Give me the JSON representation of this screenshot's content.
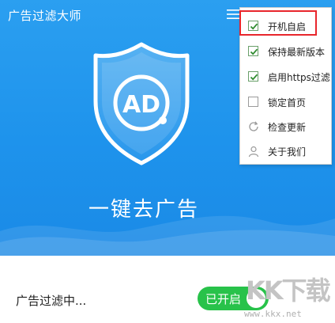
{
  "window": {
    "title": "广告过滤大师"
  },
  "hero": {
    "logo_text": "AD",
    "slogan": "一键去广告"
  },
  "footer": {
    "status_text": "广告过滤中...",
    "toggle_label": "已开启",
    "toggle_on": true
  },
  "menu": {
    "items": [
      {
        "label": "开机自启",
        "type": "checkbox",
        "checked": true,
        "highlighted": true
      },
      {
        "label": "保持最新版本",
        "type": "checkbox",
        "checked": true
      },
      {
        "label": "启用https过滤",
        "type": "checkbox",
        "checked": true
      },
      {
        "label": "锁定首页",
        "type": "checkbox",
        "checked": false
      },
      {
        "label": "检查更新",
        "type": "icon",
        "icon": "refresh-icon"
      },
      {
        "label": "关于我们",
        "type": "icon",
        "icon": "user-icon"
      }
    ]
  },
  "watermark": {
    "text": "KK下载",
    "url": "www.kkx.net"
  },
  "colors": {
    "hero_blue": "#1e93ec",
    "toggle_green": "#28c24a",
    "highlight_red": "#e8262c",
    "check_green": "#2e8b2e"
  }
}
